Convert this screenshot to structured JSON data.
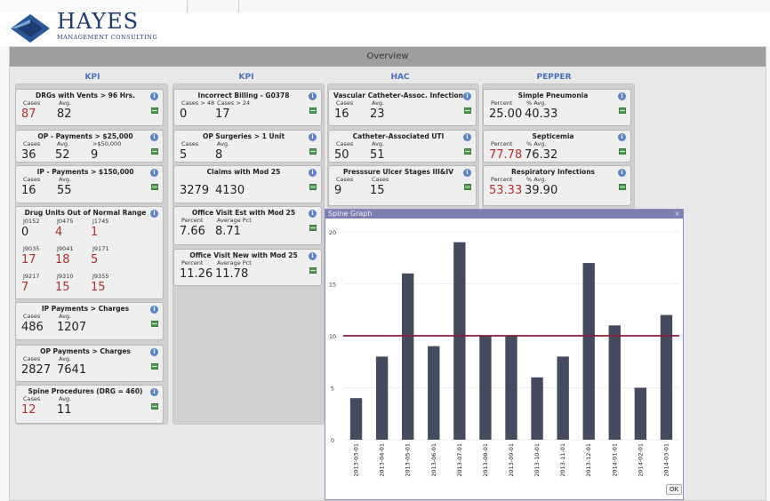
{
  "brand": {
    "name": "HAYES",
    "subtitle": "MANAGEMENT CONSULTING"
  },
  "header": {
    "title": "Overview"
  },
  "columns": [
    {
      "title": "KPI",
      "cards": [
        {
          "title": "DRGs with Vents > 96 Hrs.",
          "rows": [
            {
              "labels": [
                "Cases",
                "Avg."
              ],
              "values": [
                "87",
                "82"
              ],
              "red": [
                true,
                false
              ]
            }
          ]
        },
        {
          "title": "OP - Payments > $25,000",
          "rows": [
            {
              "labels": [
                "Cases",
                "Avg.",
                ">$50,000"
              ],
              "values": [
                "36",
                "52",
                "9"
              ],
              "red": [
                false,
                false,
                false
              ]
            }
          ]
        },
        {
          "title": "IP - Payments > $150,000",
          "rows": [
            {
              "labels": [
                "Cases",
                "Avg."
              ],
              "values": [
                "16",
                "55"
              ],
              "red": [
                false,
                false
              ]
            }
          ]
        },
        {
          "title": "Drug Units Out of Normal Range",
          "rows": [
            {
              "labels": [
                "J0152",
                "J0475",
                "J1745"
              ],
              "values": [
                "0",
                "4",
                "1"
              ],
              "red": [
                false,
                true,
                true
              ]
            },
            {
              "labels": [
                "J9035",
                "J9041",
                "J9171"
              ],
              "values": [
                "17",
                "18",
                "5"
              ],
              "red": [
                true,
                true,
                true
              ]
            },
            {
              "labels": [
                "J9217",
                "J9310",
                "J9355"
              ],
              "values": [
                "7",
                "15",
                "15"
              ],
              "red": [
                true,
                true,
                true
              ]
            }
          ]
        },
        {
          "title": "IP Payments > Charges",
          "rows": [
            {
              "labels": [
                "Cases",
                "Avg."
              ],
              "values": [
                "486",
                "1207"
              ],
              "red": [
                false,
                false
              ]
            }
          ]
        },
        {
          "title": "OP Payments > Charges",
          "rows": [
            {
              "labels": [
                "Cases",
                "Avg."
              ],
              "values": [
                "2827",
                "7641"
              ],
              "red": [
                false,
                false
              ]
            }
          ]
        },
        {
          "title": "Spine Procedures (DRG = 460)",
          "rows": [
            {
              "labels": [
                "Cases",
                "Avg."
              ],
              "values": [
                "12",
                "11"
              ],
              "red": [
                true,
                false
              ]
            }
          ]
        }
      ]
    },
    {
      "title": "KPI",
      "cards": [
        {
          "title": "Incorrect Billing - G0378",
          "rows": [
            {
              "labels": [
                "Cases > 48",
                "Cases > 24"
              ],
              "values": [
                "0",
                "17"
              ],
              "red": [
                false,
                false
              ]
            }
          ]
        },
        {
          "title": "OP Surgeries > 1 Unit",
          "rows": [
            {
              "labels": [
                "Cases",
                "Avg."
              ],
              "values": [
                "5",
                "8"
              ],
              "red": [
                false,
                false
              ]
            }
          ]
        },
        {
          "title": "Claims with Mod 25",
          "rows": [
            {
              "labels": [
                "",
                ""
              ],
              "values": [
                "3279",
                "4130"
              ],
              "red": [
                false,
                false
              ]
            }
          ]
        },
        {
          "title": "Office Visit Est with Mod 25",
          "rows": [
            {
              "labels": [
                "Percent",
                "Average Pct"
              ],
              "values": [
                "7.66",
                "8.71"
              ],
              "red": [
                false,
                false
              ]
            }
          ]
        },
        {
          "title": "Office Visit New with Mod 25",
          "rows": [
            {
              "labels": [
                "Percent",
                "Average Pct"
              ],
              "values": [
                "11.26",
                "11.78"
              ],
              "red": [
                false,
                false
              ]
            }
          ]
        }
      ]
    },
    {
      "title": "HAC",
      "cards": [
        {
          "title": "Vascular Catheter-Assoc. Infection",
          "rows": [
            {
              "labels": [
                "Cases",
                "Avg."
              ],
              "values": [
                "16",
                "23"
              ],
              "red": [
                false,
                false
              ]
            }
          ]
        },
        {
          "title": "Catheter-Associated UTI",
          "rows": [
            {
              "labels": [
                "Cases",
                "Avg."
              ],
              "values": [
                "50",
                "51"
              ],
              "red": [
                false,
                false
              ]
            }
          ]
        },
        {
          "title": "Presssure Ulcer Stages III&IV",
          "rows": [
            {
              "labels": [
                "Cases",
                "Cases"
              ],
              "values": [
                "9",
                "15"
              ],
              "red": [
                false,
                false
              ]
            }
          ]
        }
      ]
    },
    {
      "title": "PEPPER",
      "cards": [
        {
          "title": "Simple Pneumonia",
          "rows": [
            {
              "labels": [
                "Percent",
                "% Avg."
              ],
              "values": [
                "25.00",
                "40.33"
              ],
              "red": [
                false,
                false
              ]
            }
          ]
        },
        {
          "title": "Septicemia",
          "rows": [
            {
              "labels": [
                "Percent",
                "% Avg."
              ],
              "values": [
                "77.78",
                "76.32"
              ],
              "red": [
                true,
                false
              ]
            }
          ]
        },
        {
          "title": "Respiratory Infections",
          "rows": [
            {
              "labels": [
                "Percent",
                "% Avg."
              ],
              "values": [
                "53.33",
                "39.90"
              ],
              "red": [
                true,
                false
              ]
            }
          ]
        }
      ]
    }
  ],
  "dialog": {
    "title": "Spine Graph",
    "close": "×",
    "ok_label": "OK"
  },
  "chart_data": {
    "type": "bar",
    "categories": [
      "2013-03-01",
      "2013-04-01",
      "2013-05-01",
      "2013-06-01",
      "2013-07-01",
      "2013-08-01",
      "2013-09-01",
      "2013-10-01",
      "2013-11-01",
      "2013-12-01",
      "2014-01-01",
      "2014-02-01",
      "2014-03-01"
    ],
    "values": [
      4,
      8,
      16,
      9,
      19,
      10,
      10,
      6,
      8,
      17,
      11,
      5,
      12
    ],
    "reference_line": 10,
    "yticks": [
      "0",
      "5",
      "10",
      "15",
      "20"
    ],
    "ylim": [
      0,
      20
    ],
    "bar_color": "#454b5e",
    "line_color": "#8a1c3a"
  }
}
